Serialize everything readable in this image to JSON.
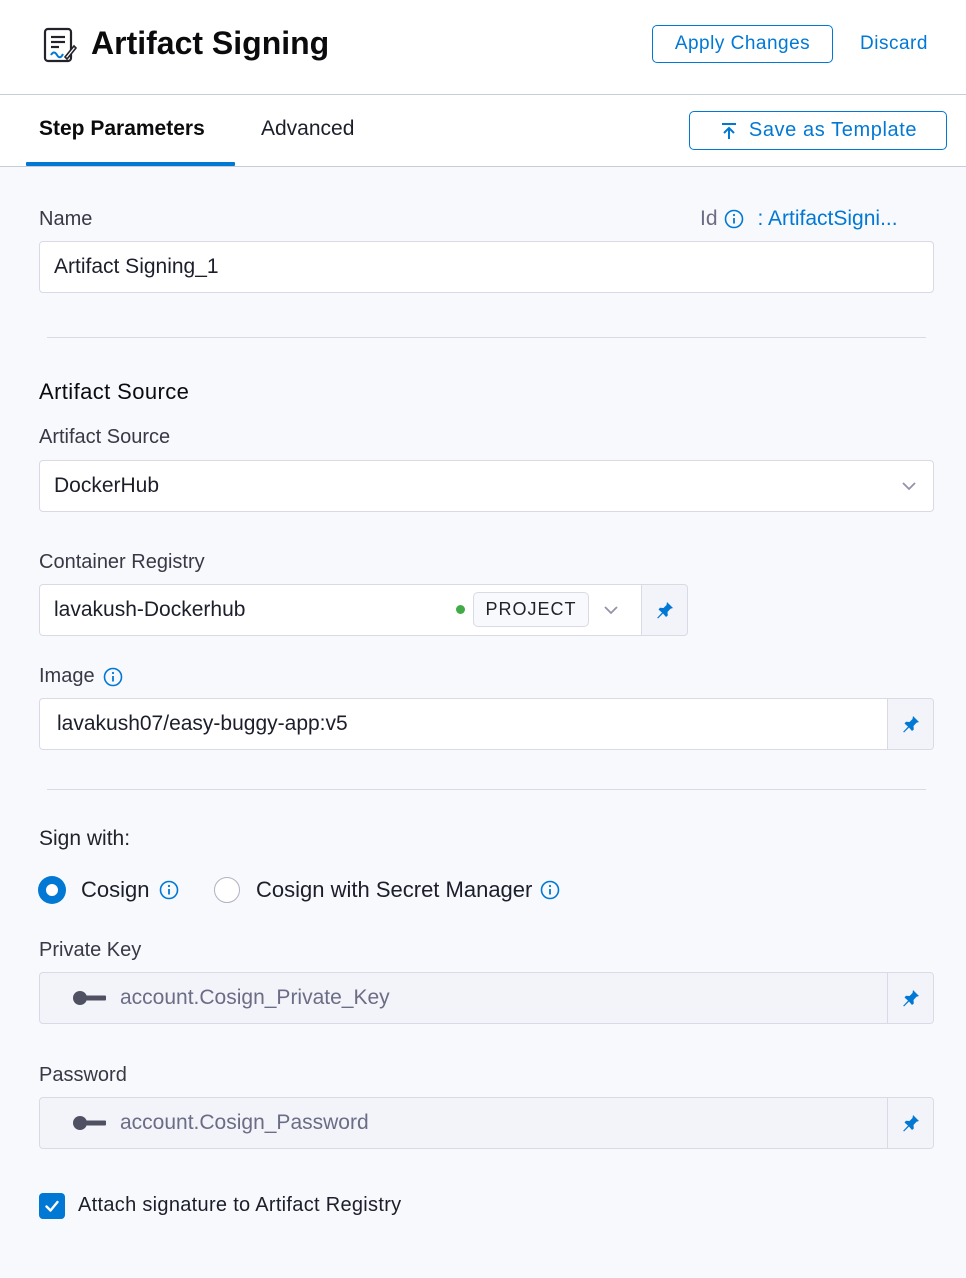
{
  "header": {
    "title": "Artifact Signing",
    "apply_label": "Apply Changes",
    "discard_label": "Discard"
  },
  "tabs": [
    {
      "label": "Step Parameters",
      "active": true
    },
    {
      "label": "Advanced",
      "active": false
    }
  ],
  "save_template_label": "Save as Template",
  "name_field": {
    "label": "Name",
    "value": "Artifact Signing_1",
    "id_label": "Id",
    "id_value": ": ArtifactSigni..."
  },
  "artifact_source": {
    "heading": "Artifact Source",
    "label": "Artifact Source",
    "value": "DockerHub"
  },
  "container_registry": {
    "label": "Container Registry",
    "value": "lavakush-Dockerhub",
    "scope_tag": "PROJECT"
  },
  "image": {
    "label": "Image",
    "value": "lavakush07/easy-buggy-app:v5"
  },
  "sign_with": {
    "label": "Sign with:",
    "options": [
      {
        "label": "Cosign",
        "selected": true
      },
      {
        "label": "Cosign with Secret Manager",
        "selected": false
      }
    ]
  },
  "private_key": {
    "label": "Private Key",
    "value": "account.Cosign_Private_Key"
  },
  "password": {
    "label": "Password",
    "value": "account.Cosign_Password"
  },
  "attach_signature": {
    "label": "Attach signature to Artifact Registry",
    "checked": true
  },
  "colors": {
    "accent": "#0278d5",
    "background": "#f7f9fc",
    "status_green": "#42ab45"
  }
}
